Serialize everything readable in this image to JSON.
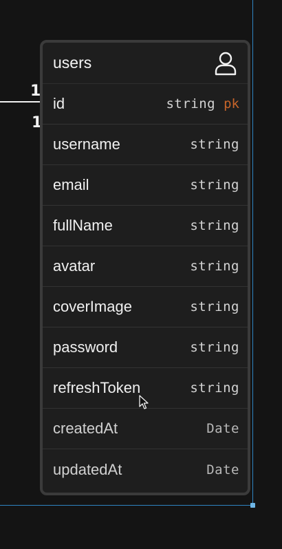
{
  "relation": {
    "label_top": "1",
    "label_bottom": "1"
  },
  "table": {
    "title": "users",
    "icon": "user-icon",
    "fields": [
      {
        "name": "id",
        "type": "string",
        "key": "pk"
      },
      {
        "name": "username",
        "type": "string",
        "key": ""
      },
      {
        "name": "email",
        "type": "string",
        "key": ""
      },
      {
        "name": "fullName",
        "type": "string",
        "key": ""
      },
      {
        "name": "avatar",
        "type": "string",
        "key": ""
      },
      {
        "name": "coverImage",
        "type": "string",
        "key": ""
      },
      {
        "name": "password",
        "type": "string",
        "key": ""
      },
      {
        "name": "refreshToken",
        "type": "string",
        "key": ""
      },
      {
        "name": "createdAt",
        "type": "Date",
        "key": ""
      },
      {
        "name": "updatedAt",
        "type": "Date",
        "key": ""
      }
    ]
  },
  "colors": {
    "background": "#141414",
    "card": "#1e1e1e",
    "card_border": "#3b3b3b",
    "selection": "#2f86c4",
    "primary_key": "#c8652a"
  }
}
